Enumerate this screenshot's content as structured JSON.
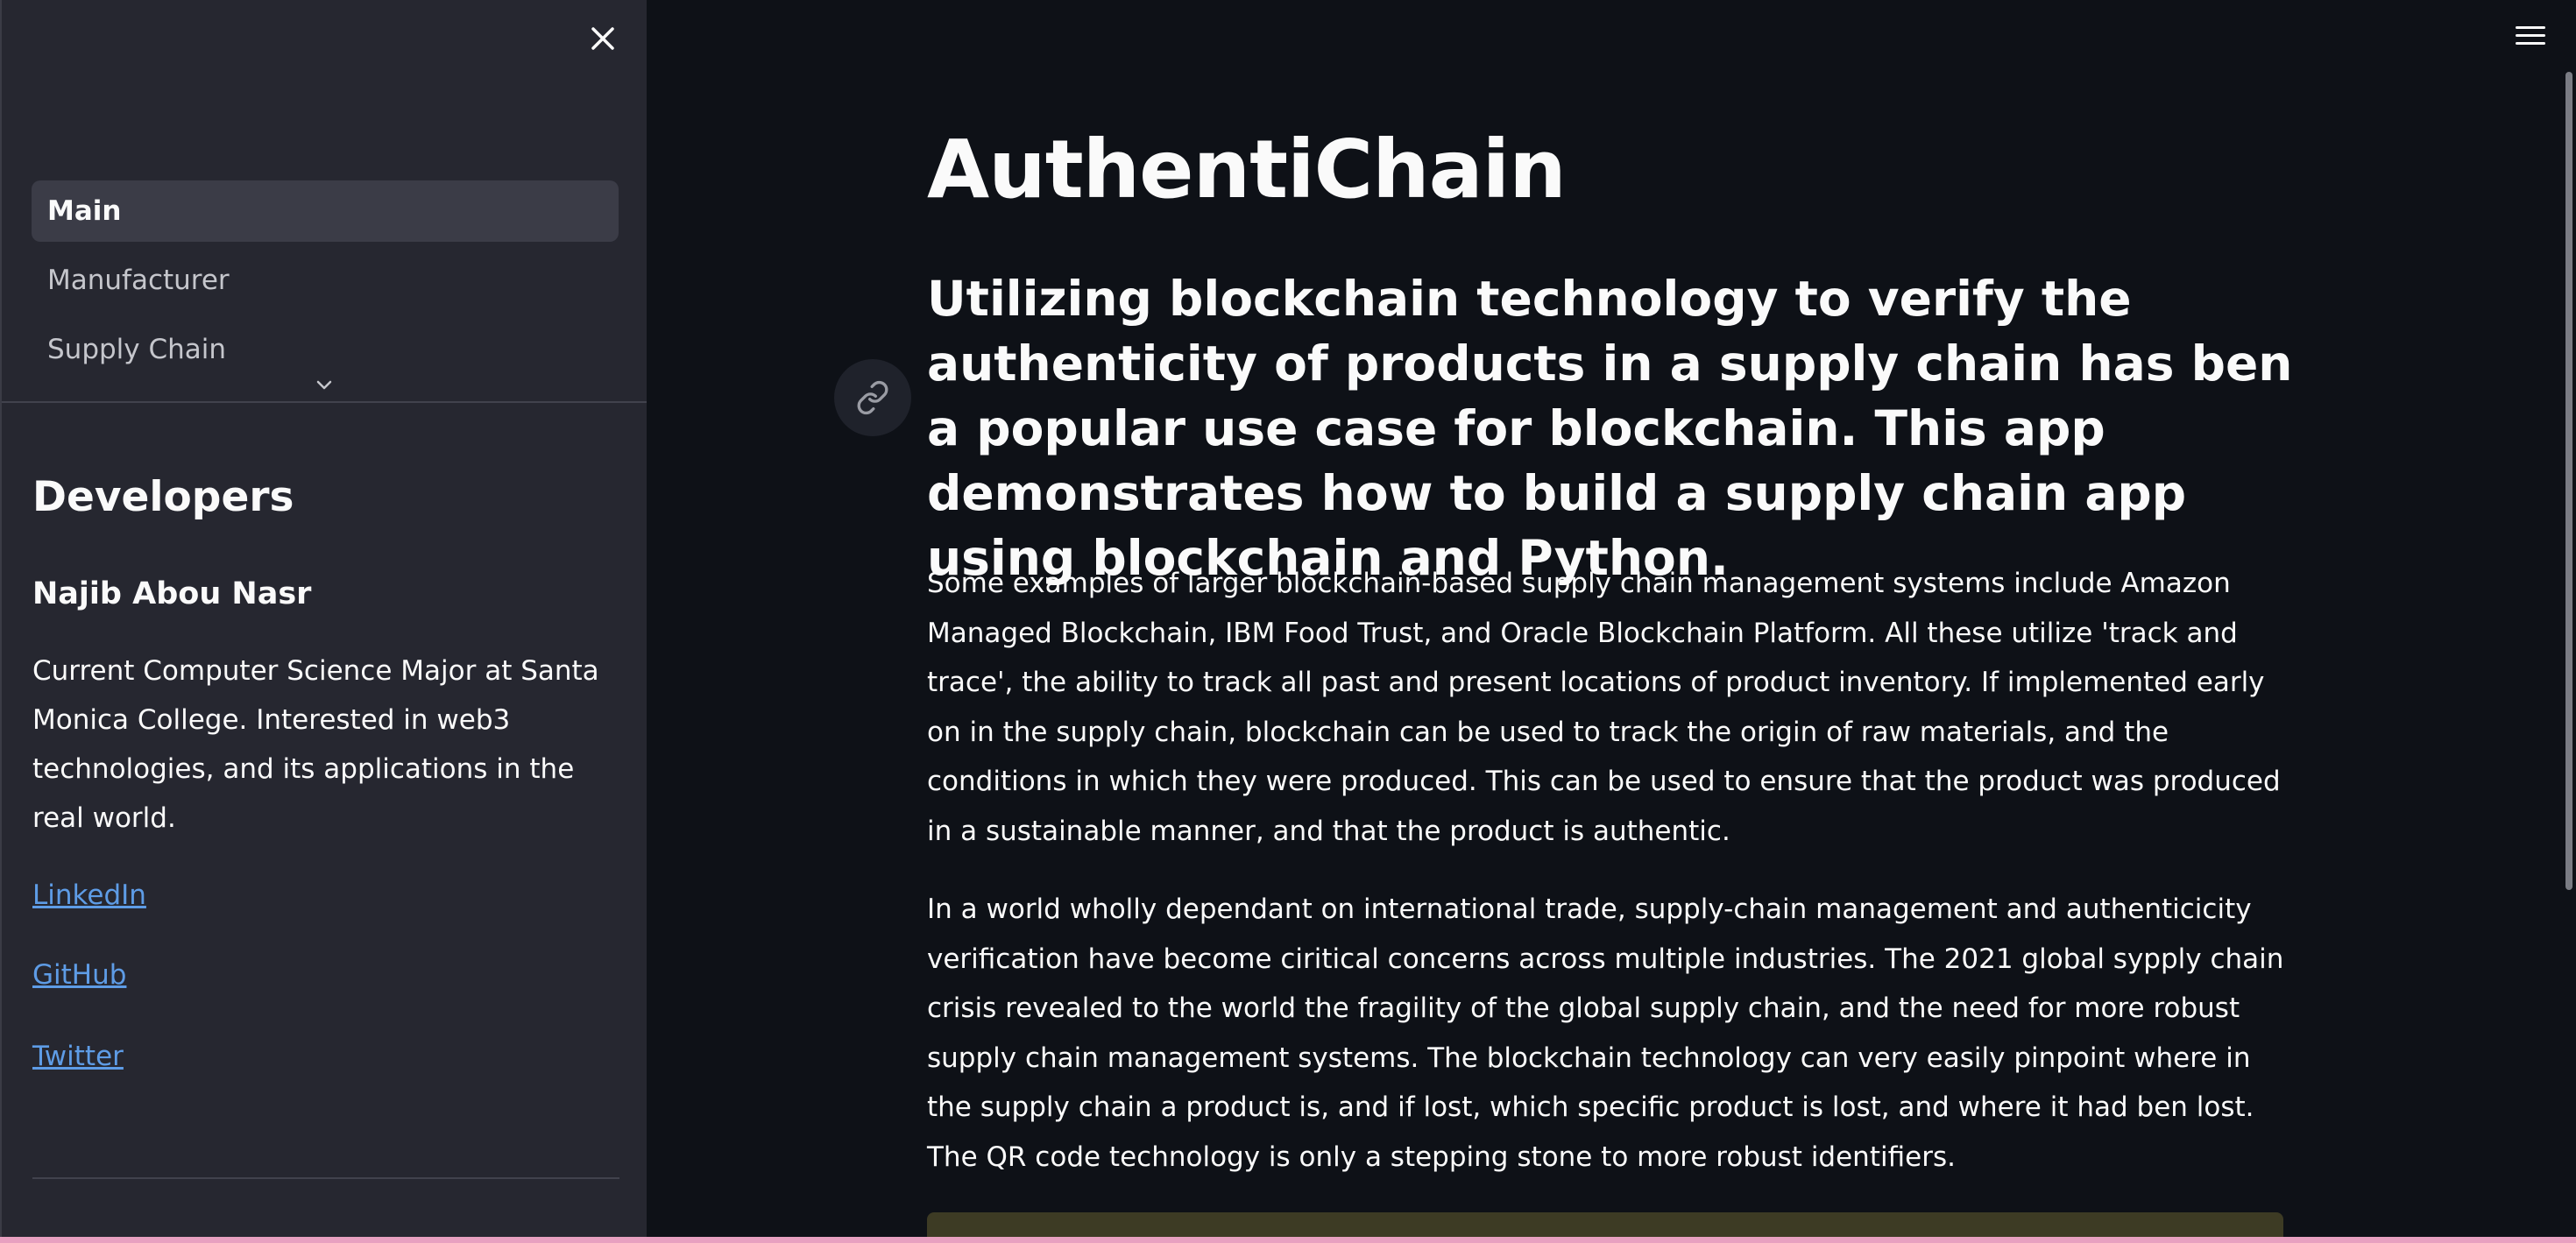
{
  "sidebar": {
    "close_icon": "close-icon",
    "nav_items": [
      {
        "label": "Main",
        "active": true
      },
      {
        "label": "Manufacturer",
        "active": false
      },
      {
        "label": "Supply Chain",
        "active": false
      }
    ],
    "expand_icon": "chevron-down-icon",
    "developers_heading": "Developers",
    "developer_name": "Najib Abou Nasr",
    "developer_bio": "Current Computer Science Major at Santa Monica College. Interested in web3 technologies, and its applications in the real world.",
    "links": [
      "LinkedIn",
      "GitHub",
      "Twitter"
    ]
  },
  "main": {
    "menu_icon": "hamburger-menu-icon",
    "title": "AuthentiChain",
    "anchor_icon": "link-icon",
    "subtitle": "Utilizing blockchain technology to verify the authenticity of products in a supply chain has ben a popular use case for blockchain. This app demonstrates how to build a supply chain app using blockchain and Python.",
    "paragraph1": "Some examples of larger blockchain-based supply chain management systems include Amazon Managed Blockchain, IBM Food Trust, and Oracle Blockchain Platform. All these utilize 'track and trace', the ability to track all past and present locations of product inventory. If implemented early on in the supply chain, blockchain can be used to track the origin of raw materials, and the conditions in which they were produced. This can be used to ensure that the product was produced in a sustainable manner, and that the product is authentic.",
    "paragraph2": "In a world wholly dependant on international trade, supply-chain management and authenticicity verification have become ciritical concerns across multiple industries. The 2021 global sypply chain crisis revealed to the world the fragility of the global supply chain, and the need for more robust supply chain management systems. The blockchain technology can very easily pinpoint where in the supply chain a product is, and if lost, which specific product is lost, and where it had ben lost. The QR code technology is only a stepping stone to more robust identifiers."
  },
  "colors": {
    "sidebar_bg": "#262730",
    "main_bg": "#0e1117",
    "text": "#fafafa",
    "link": "#5e9ce6",
    "active_nav_bg": "#3b3c47",
    "callout_bg": "#3d3b24"
  }
}
